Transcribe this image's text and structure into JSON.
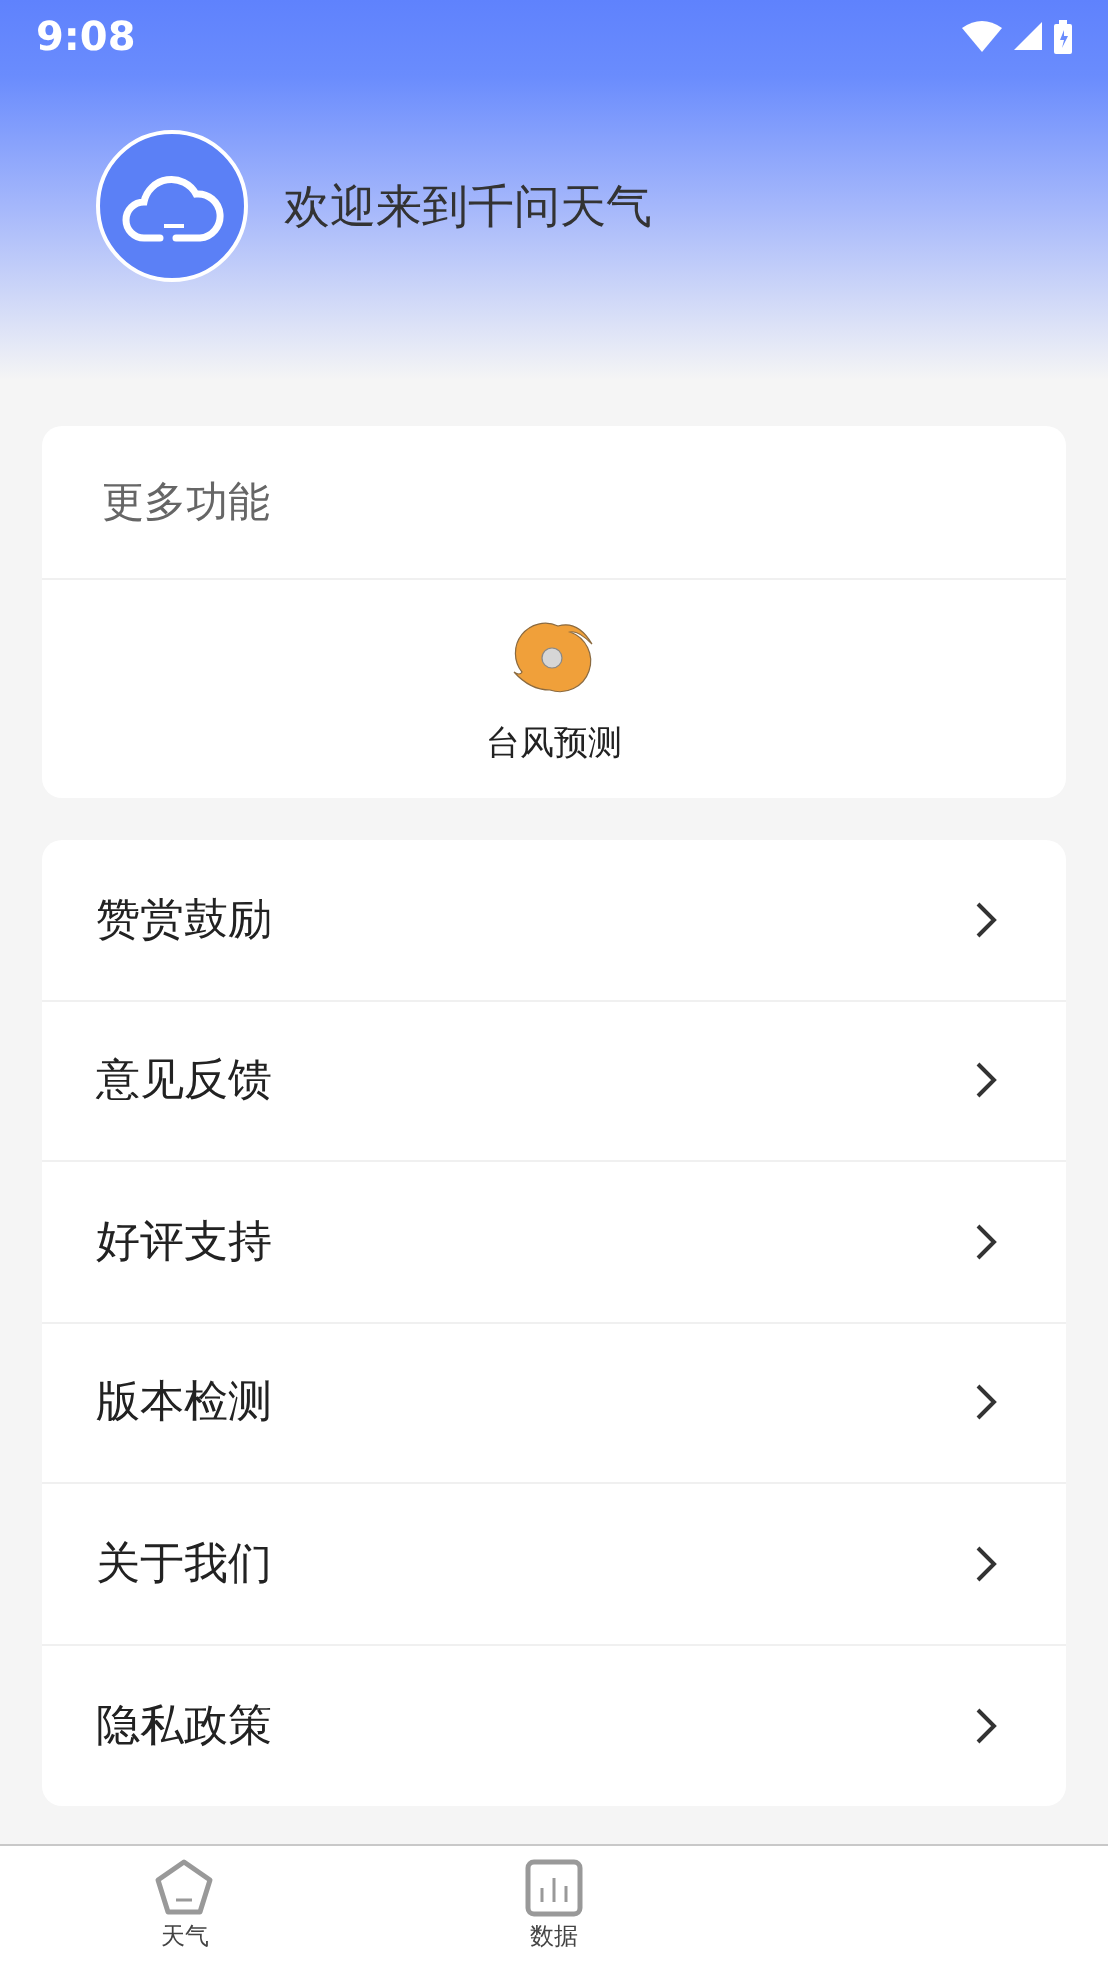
{
  "status_bar": {
    "time": "9:08"
  },
  "header": {
    "welcome": "欢迎来到千问天气"
  },
  "more_features": {
    "title": "更多功能",
    "items": [
      {
        "label": "台风预测"
      }
    ]
  },
  "menu": [
    {
      "label": "赞赏鼓励"
    },
    {
      "label": "意见反馈"
    },
    {
      "label": "好评支持"
    },
    {
      "label": "版本检测"
    },
    {
      "label": "关于我们"
    },
    {
      "label": "隐私政策"
    }
  ],
  "bottom_nav": [
    {
      "label": "天气",
      "kind": "home",
      "selected": false
    },
    {
      "label": "数据",
      "kind": "chart",
      "selected": false
    }
  ]
}
